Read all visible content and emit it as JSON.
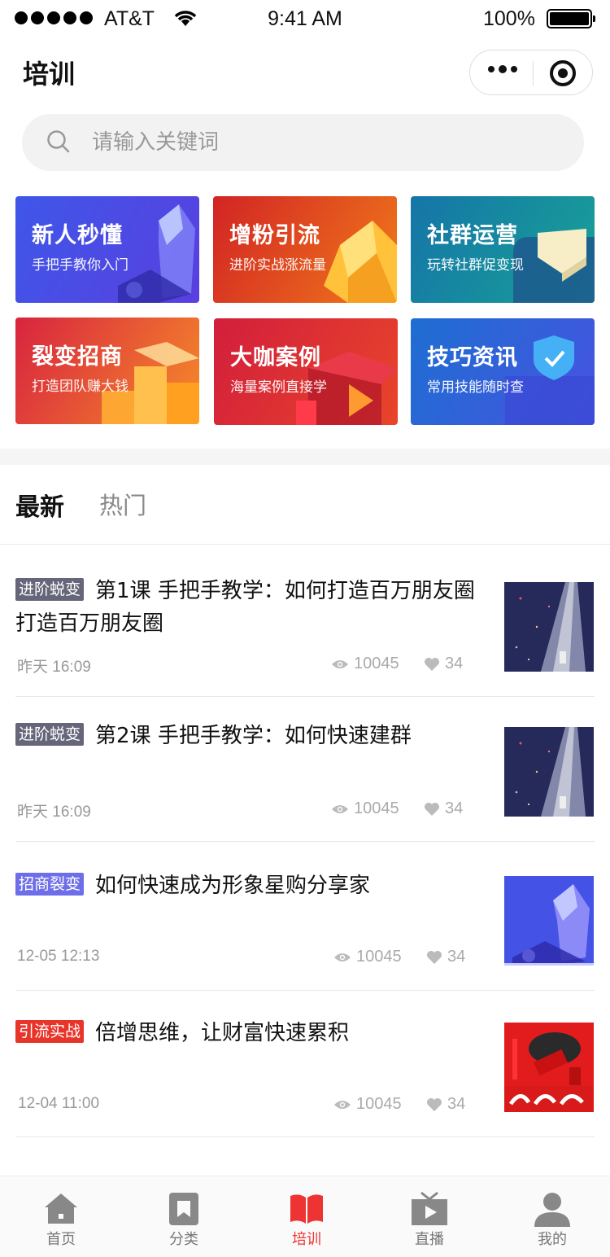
{
  "status_bar": {
    "carrier": "AT&T",
    "time": "9:41 AM",
    "battery": "100%"
  },
  "header": {
    "title": "培训"
  },
  "search": {
    "placeholder": "请输入关键词"
  },
  "categories": [
    {
      "title": "新人秒懂",
      "subtitle": "手把手教你入门",
      "color": "#3d4fe0"
    },
    {
      "title": "增粉引流",
      "subtitle": "进阶实战涨流量",
      "color": "#e0381a"
    },
    {
      "title": "社群运营",
      "subtitle": "玩转社群促变现",
      "color": "#157fa0"
    },
    {
      "title": "裂变招商",
      "subtitle": "打造团队赚大钱",
      "color": "#e8404a"
    },
    {
      "title": "大咖案例",
      "subtitle": "海量案例直接学",
      "color": "#c81f3a"
    },
    {
      "title": "技巧资讯",
      "subtitle": "常用技能随时查",
      "color": "#2a62d8"
    }
  ],
  "tabs": {
    "latest": "最新",
    "hot": "热门"
  },
  "articles": [
    {
      "tag": "进阶蜕变",
      "tag_color": "#66667a",
      "title": "第1课  手把手教学：如何打造百万朋友圈打造百万朋友圈",
      "date": "昨天 16:09",
      "views": "10045",
      "likes": "34"
    },
    {
      "tag": "进阶蜕变",
      "tag_color": "#66667a",
      "title": "第2课  手把手教学：如何快速建群",
      "date": "昨天 16:09",
      "views": "10045",
      "likes": "34"
    },
    {
      "tag": "招商裂变",
      "tag_color": "#6e6fe8",
      "title": "如何快速成为形象星购分享家",
      "date": "12-05 12:13",
      "views": "10045",
      "likes": "34"
    },
    {
      "tag": "引流实战",
      "tag_color": "#e8352a",
      "title": "倍增思维，让财富快速累积",
      "date": "12-04 11:00",
      "views": "10045",
      "likes": "34"
    }
  ],
  "tabbar": {
    "home": "首页",
    "category": "分类",
    "training": "培训",
    "live": "直播",
    "mine": "我的"
  },
  "colors": {
    "accent": "#e33333",
    "inactive": "#777777"
  }
}
